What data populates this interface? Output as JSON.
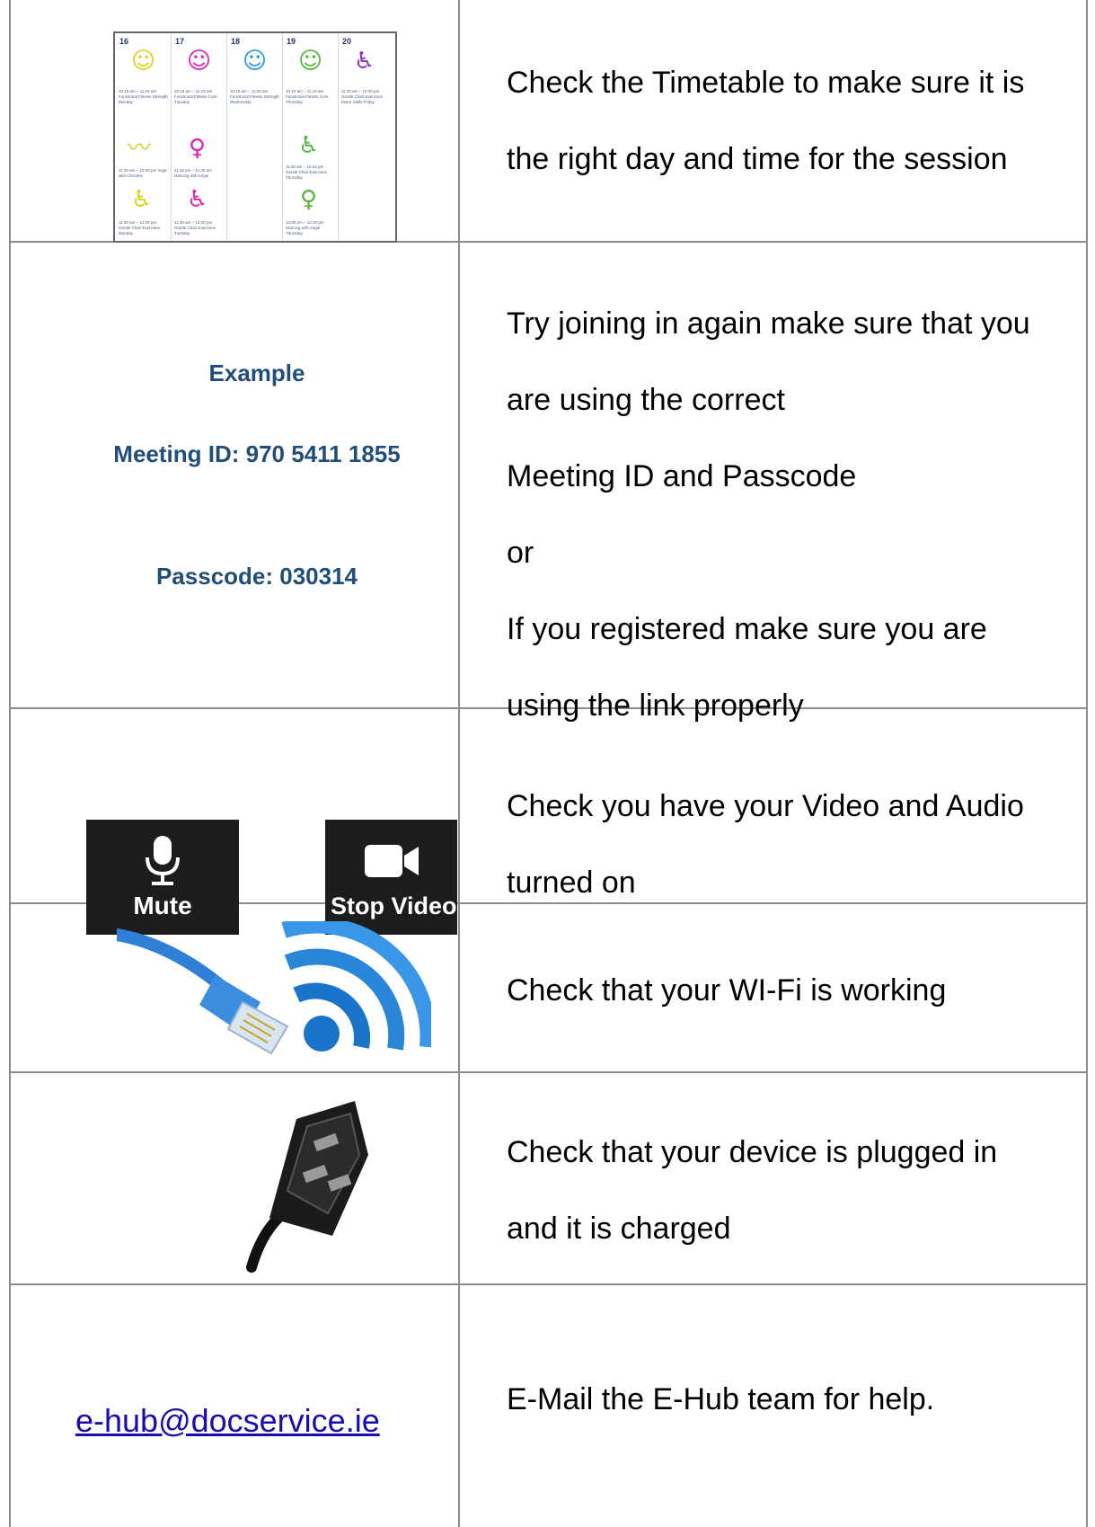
{
  "timetable": {
    "days": [
      "16",
      "17",
      "18",
      "19",
      "20"
    ],
    "captions": [
      "10:15 am – 11:15 am Functional Fitness Strength Monday",
      "10:15 am – 11:15 am Functional Fitness Core Tuesday",
      "10:15 am – 11:00 am Functional Fitness Strength Wednesday",
      "10:15 am – 11:15 am Functional Fitness Core Thursday",
      "11:30 am – 12:00 pm Gentle Chair Exercises Motor Skills Friday",
      "11:30 am – 12:00 pm Yoga with Christine",
      "11:15 am – 11:45 am Dancing with Angie",
      "11:30 am – 12:15 pm Gentle Chair Exercises Thursday",
      "11:30 am – 12:00 pm Gentle Chair Exercises Monday",
      "11:30 am – 12:00 pm Gentle Chair Exercises Tuesday",
      "12:00 pm – 12:30 pm Dancing with Angie Thursday"
    ],
    "accent_colors": {
      "yellow": "#d9d21c",
      "magenta": "#e020b0",
      "blue": "#2b9ad8",
      "green": "#56b63a",
      "purple": "#8b2fc9"
    }
  },
  "rows": [
    {
      "lines": [
        "Check the Timetable to make sure it is",
        "the right day and time for the session"
      ]
    },
    {
      "lines": [
        "Try joining in again make sure that you",
        "are using the correct",
        "Meeting ID and Passcode",
        "or",
        "If you registered make sure you are",
        "using the link properly"
      ]
    },
    {
      "lines": [
        "Check you have your Video and Audio",
        "turned on"
      ]
    },
    {
      "lines": [
        "Check that your WI-Fi is working"
      ]
    },
    {
      "lines": [
        "Check that your device is plugged in",
        "and it is charged"
      ]
    },
    {
      "lines": [
        "E-Mail the E-Hub team for help."
      ]
    }
  ],
  "example": {
    "heading": "Example",
    "meeting_id": "Meeting ID: 970 5411 1855",
    "passcode": "Passcode: 030314"
  },
  "buttons": {
    "mute_label": "Mute",
    "stop_video_label": "Stop Video"
  },
  "contact": {
    "email": "e-hub@docservice.ie",
    "link_color": "#1a0dab"
  },
  "icons": [
    "microphone-icon",
    "video-camera-icon",
    "ethernet-cable-icon",
    "wifi-icon",
    "power-plug-icon"
  ]
}
